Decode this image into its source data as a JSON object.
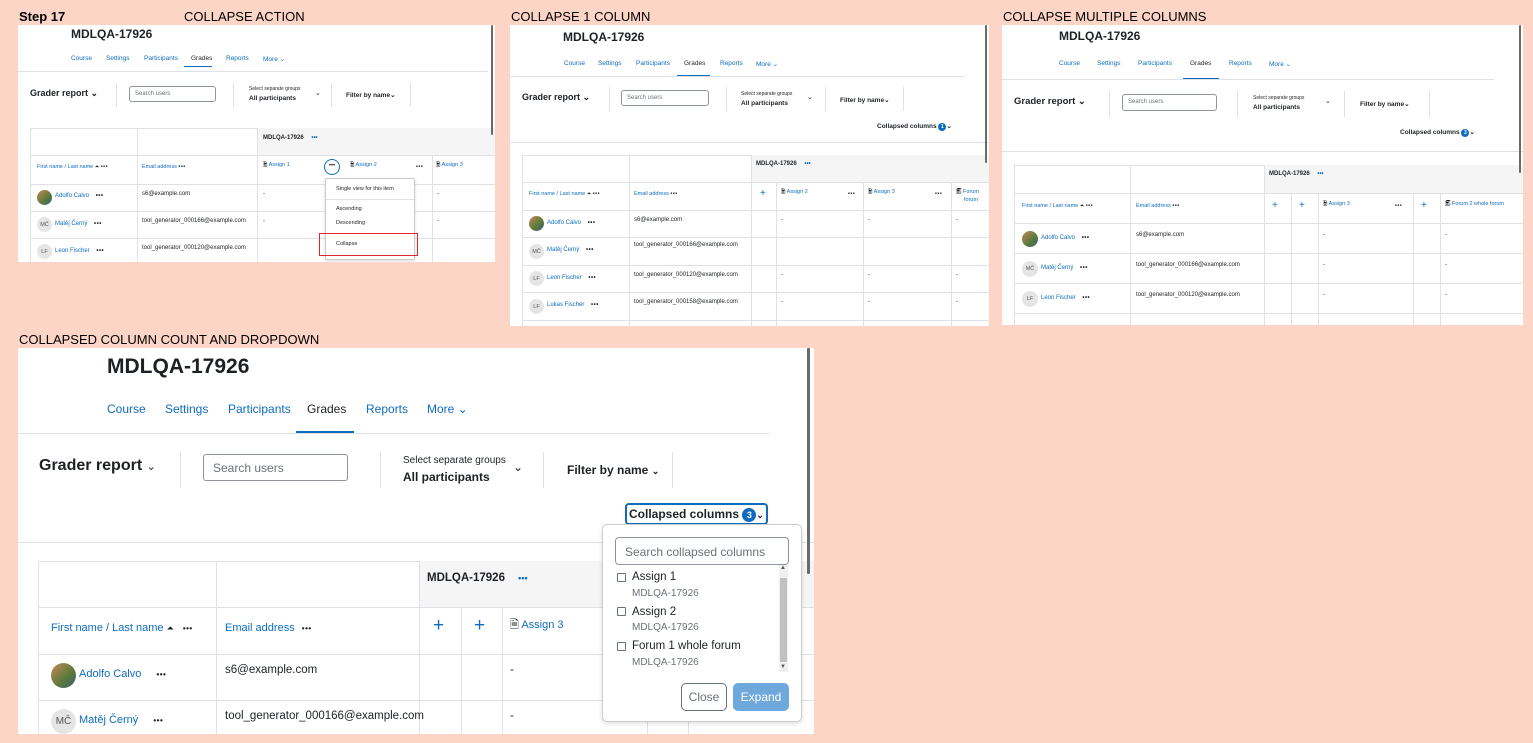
{
  "captions": {
    "step": "Step 17",
    "p1": "COLLAPSE ACTION",
    "p2": "COLLAPSE 1 COLUMN",
    "p3": "COLLAPSE MULTIPLE COLUMNS",
    "p4": "COLLAPSED COLUMN COUNT AND DROPDOWN"
  },
  "course": "MDLQA-17926",
  "nav": {
    "course": "Course",
    "settings": "Settings",
    "participants": "Participants",
    "grades": "Grades",
    "reports": "Reports",
    "more": "More"
  },
  "report": {
    "title": "Grader report",
    "search_placeholder": "Search users",
    "groups_label": "Select separate groups",
    "groups_value": "All participants",
    "filter": "Filter by name",
    "collapsed_label": "Collapsed columns",
    "collapsed_count_1": "1",
    "collapsed_count_3": "3"
  },
  "columns": {
    "name": "First name / Last name",
    "email": "Email address",
    "assign1": "Assign 1",
    "assign2": "Assign 2",
    "assign3": "Assign 3",
    "forum1": "Forum",
    "forum2": "Forum 2 whole forum",
    "forum_short1": "Forum",
    "forum_short2": "forum"
  },
  "students": [
    {
      "name": "Adolfo Calvo",
      "initials": "",
      "email": "s6@example.com"
    },
    {
      "name": "Matěj Černý",
      "initials": "MČ",
      "email": "tool_generator_000166@example.com"
    },
    {
      "name": "Leon Fischer",
      "initials": "LF",
      "email": "tool_generator_000120@example.com"
    },
    {
      "name": "Lukas Fischer",
      "initials": "LF",
      "email": "tool_generator_000158@example.com"
    }
  ],
  "dash": "-",
  "menu": {
    "single": "Single view for this item",
    "asc": "Ascending",
    "desc": "Descending",
    "collapse": "Collapse"
  },
  "dropdown": {
    "search_placeholder": "Search collapsed columns",
    "items": [
      {
        "name": "Assign 1",
        "sub": "MDLQA-17926"
      },
      {
        "name": "Assign 2",
        "sub": "MDLQA-17926"
      },
      {
        "name": "Forum 1 whole forum",
        "sub": "MDLQA-17926"
      }
    ],
    "close": "Close",
    "expand": "Expand"
  },
  "ellipsis": "•••"
}
